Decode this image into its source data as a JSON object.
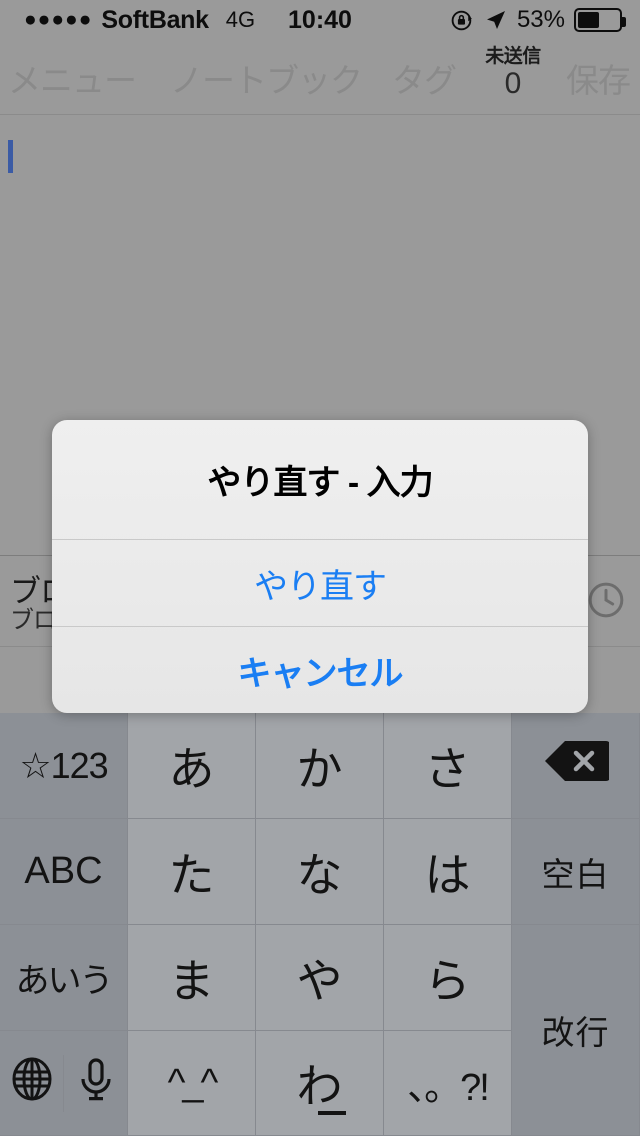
{
  "status_bar": {
    "signal_dots": "●●●●●",
    "carrier": "SoftBank",
    "network": "4G",
    "time": "10:40",
    "battery_percent": "53%",
    "battery_level": 53,
    "icons": [
      "rotation-lock-icon",
      "location-arrow-icon",
      "battery-icon"
    ]
  },
  "nav_bar": {
    "menu_label": "メニュー",
    "notebook_label": "ノートブック",
    "tag_label": "タグ",
    "unsent_label": "未送信",
    "unsent_count": "0",
    "save_label": "保存",
    "inactive_color": "#8a8a8a"
  },
  "note": {
    "body_text": "",
    "caret_visible": true
  },
  "suggest_bar": {
    "word_primary": "ブロ",
    "word_secondary": "ブロ",
    "history_icon": "clock-history-icon"
  },
  "alert": {
    "title": "やり直す - 入力",
    "confirm_label": "やり直す",
    "cancel_label": "キャンセル",
    "tint_color": "#1a7ef3"
  },
  "keyboard": {
    "rows": [
      [
        {
          "name": "key-symbols-numbers",
          "label": "☆123",
          "type": "fn"
        },
        {
          "name": "key-a",
          "label": "あ",
          "type": "char"
        },
        {
          "name": "key-ka",
          "label": "か",
          "type": "char"
        },
        {
          "name": "key-sa",
          "label": "さ",
          "type": "char"
        },
        {
          "name": "key-delete",
          "label": "",
          "type": "fn-icon",
          "icon": "delete-backspace-icon"
        }
      ],
      [
        {
          "name": "key-abc",
          "label": "ABC",
          "type": "fn"
        },
        {
          "name": "key-ta",
          "label": "た",
          "type": "char"
        },
        {
          "name": "key-na",
          "label": "な",
          "type": "char"
        },
        {
          "name": "key-ha",
          "label": "は",
          "type": "char"
        },
        {
          "name": "key-space",
          "label": "空白",
          "type": "fn"
        }
      ],
      [
        {
          "name": "key-kana-mode",
          "label": "あいう",
          "type": "fn"
        },
        {
          "name": "key-ma",
          "label": "ま",
          "type": "char"
        },
        {
          "name": "key-ya",
          "label": "や",
          "type": "char"
        },
        {
          "name": "key-ra",
          "label": "ら",
          "type": "char"
        },
        {
          "name": "key-return",
          "label": "改行",
          "type": "fn"
        }
      ],
      [
        {
          "name": "key-globe",
          "label": "",
          "type": "fn-icon",
          "icon": "globe-icon"
        },
        {
          "name": "key-dictation",
          "label": "",
          "type": "fn-icon",
          "icon": "microphone-icon"
        },
        {
          "name": "key-emoticon",
          "label": "^_^",
          "type": "char"
        },
        {
          "name": "key-wa",
          "label": "わ",
          "type": "char"
        },
        {
          "name": "key-punctuation",
          "label": "、。?!",
          "type": "char"
        }
      ]
    ]
  }
}
